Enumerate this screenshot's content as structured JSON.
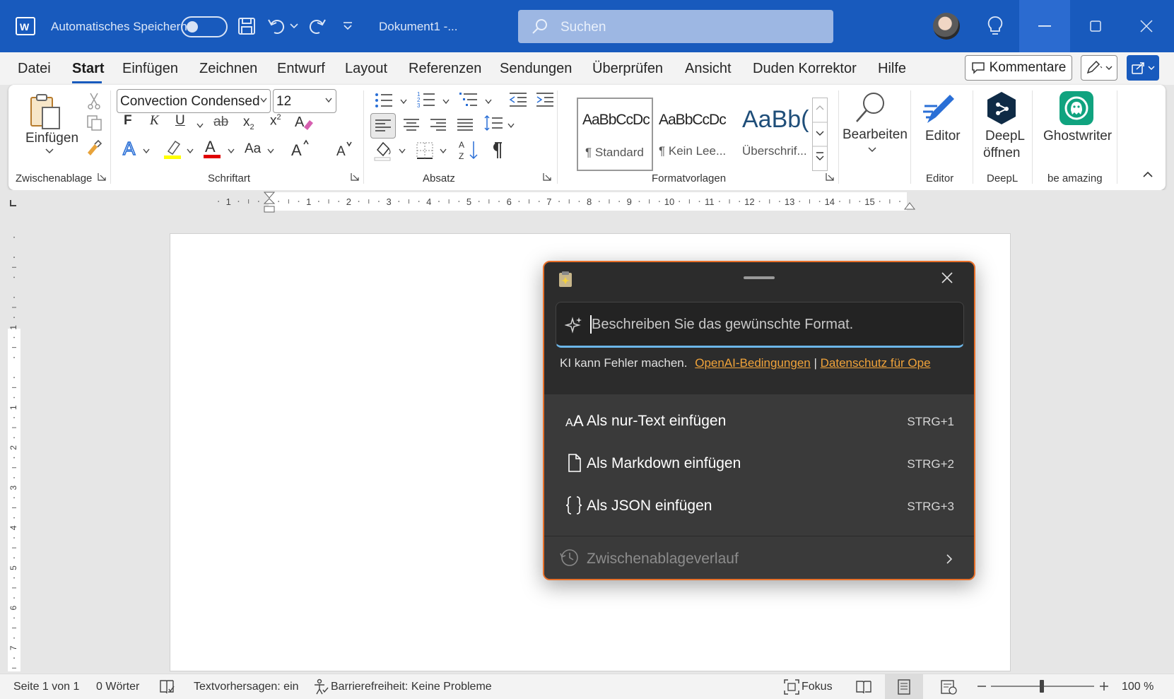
{
  "titlebar": {
    "autosave_label": "Automatisches Speichern",
    "doc_title": "Dokument1  -...",
    "search_placeholder": "Suchen"
  },
  "menu": {
    "items": [
      "Datei",
      "Start",
      "Einfügen",
      "Zeichnen",
      "Entwurf",
      "Layout",
      "Referenzen",
      "Sendungen",
      "Überprüfen",
      "Ansicht",
      "Duden Korrektor",
      "Hilfe"
    ],
    "active": "Start",
    "comments_label": "Kommentare"
  },
  "ribbon": {
    "clipboard": {
      "paste_label": "Einfügen",
      "group_label": "Zwischenablage"
    },
    "font": {
      "font_name": "Convection Condensed",
      "font_size": "12",
      "group_label": "Schriftart",
      "bold": "F",
      "italic": "K",
      "underline": "U",
      "strike": "ab",
      "sub": "x",
      "sup": "x",
      "aa": "Aa"
    },
    "paragraph": {
      "group_label": "Absatz"
    },
    "styles": {
      "group_label": "Formatvorlagen",
      "items": [
        {
          "sample": "AaBbCcDc",
          "name": "¶ Standard"
        },
        {
          "sample": "AaBbCcDc",
          "name": "¶ Kein Lee..."
        },
        {
          "sample": "AaBb(",
          "name": "Überschrif..."
        }
      ]
    },
    "edit": {
      "label": "Bearbeiten"
    },
    "editor": {
      "label": "Editor",
      "group_label": "Editor"
    },
    "deepl": {
      "label_line1": "DeepL",
      "label_line2": "öffnen",
      "group_label": "DeepL"
    },
    "ghostwriter": {
      "label": "Ghostwriter",
      "group_label": "be amazing"
    }
  },
  "ruler": {
    "numbers": [
      "1",
      "1",
      "2",
      "3",
      "4",
      "5",
      "6",
      "7",
      "8",
      "9",
      "10",
      "11",
      "12",
      "13",
      "14",
      "15"
    ]
  },
  "vruler": {
    "numbers": [
      "1",
      "1",
      "2",
      "3",
      "4",
      "5",
      "6",
      "7",
      "8"
    ]
  },
  "popup": {
    "input_placeholder": "Beschreiben Sie das gewünschte Format.",
    "disclaimer": "KI kann Fehler machen.",
    "link1": "OpenAI-Bedingungen",
    "link_sep": "|",
    "link2": "Datenschutz für Ope",
    "options": [
      {
        "label": "Als nur-Text einfügen",
        "shortcut": "STRG+1",
        "icon": "text-icon"
      },
      {
        "label": "Als Markdown einfügen",
        "shortcut": "STRG+2",
        "icon": "document-icon"
      },
      {
        "label": "Als JSON einfügen",
        "shortcut": "STRG+3",
        "icon": "braces-icon"
      }
    ],
    "history_label": "Zwischenablageverlauf"
  },
  "status": {
    "page": "Seite 1 von 1",
    "words": "0 Wörter",
    "predictions": "Textvorhersagen: ein",
    "accessibility": "Barrierefreiheit: Keine Probleme",
    "focus": "Fokus",
    "zoom": "100 %"
  },
  "colors": {
    "brand": "#185abd",
    "popup_accent": "#e8702a",
    "link": "#f0a33a"
  }
}
